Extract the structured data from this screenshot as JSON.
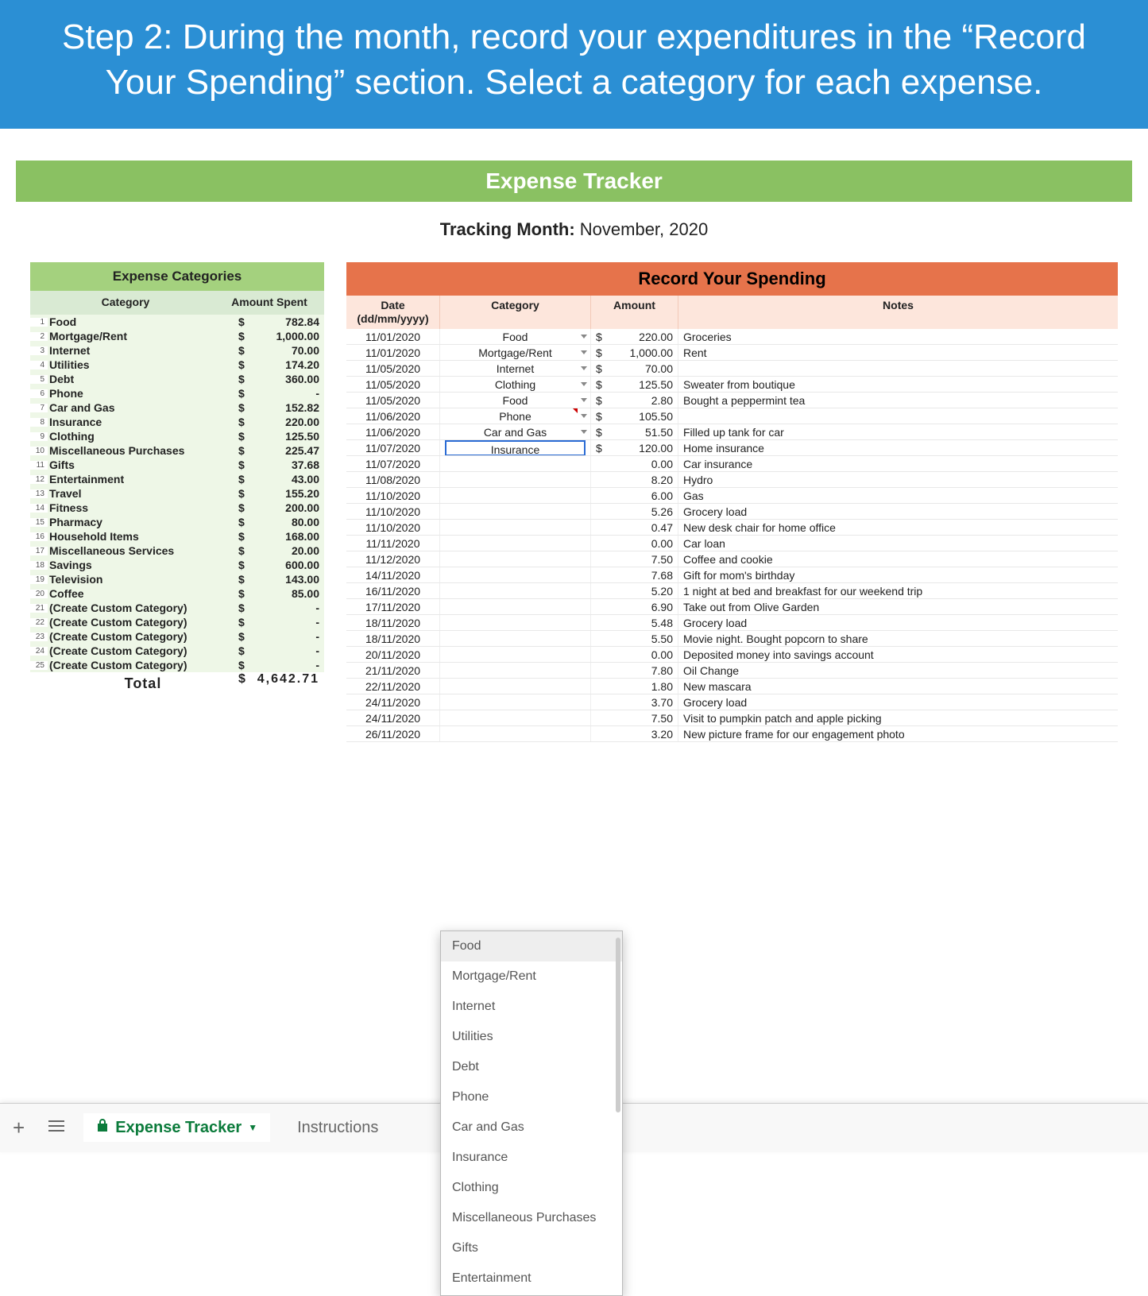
{
  "banner": "Step 2: During the month, record your expenditures in the “Record Your Spending” section. Select a category for each expense.",
  "tracker_title": "Expense Tracker",
  "month_label": "Tracking Month:",
  "month_value": "November, 2020",
  "categories_header": "Expense Categories",
  "categories_col1": "Category",
  "categories_col2": "Amount Spent",
  "total_label": "Total",
  "total_amount": "4,642.71",
  "categories": [
    {
      "n": "1",
      "name": "Food",
      "amt": "782.84"
    },
    {
      "n": "2",
      "name": "Mortgage/Rent",
      "amt": "1,000.00"
    },
    {
      "n": "3",
      "name": "Internet",
      "amt": "70.00"
    },
    {
      "n": "4",
      "name": "Utilities",
      "amt": "174.20"
    },
    {
      "n": "5",
      "name": "Debt",
      "amt": "360.00"
    },
    {
      "n": "6",
      "name": "Phone",
      "amt": "-"
    },
    {
      "n": "7",
      "name": "Car and Gas",
      "amt": "152.82"
    },
    {
      "n": "8",
      "name": "Insurance",
      "amt": "220.00"
    },
    {
      "n": "9",
      "name": "Clothing",
      "amt": "125.50"
    },
    {
      "n": "10",
      "name": "Miscellaneous Purchases",
      "amt": "225.47"
    },
    {
      "n": "11",
      "name": "Gifts",
      "amt": "37.68"
    },
    {
      "n": "12",
      "name": "Entertainment",
      "amt": "43.00"
    },
    {
      "n": "13",
      "name": "Travel",
      "amt": "155.20"
    },
    {
      "n": "14",
      "name": "Fitness",
      "amt": "200.00"
    },
    {
      "n": "15",
      "name": "Pharmacy",
      "amt": "80.00"
    },
    {
      "n": "16",
      "name": "Household Items",
      "amt": "168.00"
    },
    {
      "n": "17",
      "name": "Miscellaneous Services",
      "amt": "20.00"
    },
    {
      "n": "18",
      "name": "Savings",
      "amt": "600.00"
    },
    {
      "n": "19",
      "name": "Television",
      "amt": "143.00"
    },
    {
      "n": "20",
      "name": "Coffee",
      "amt": "85.00"
    },
    {
      "n": "21",
      "name": "(Create Custom Category)",
      "amt": "-"
    },
    {
      "n": "22",
      "name": "(Create Custom Category)",
      "amt": "-"
    },
    {
      "n": "23",
      "name": "(Create Custom Category)",
      "amt": "-"
    },
    {
      "n": "24",
      "name": "(Create Custom Category)",
      "amt": "-"
    },
    {
      "n": "25",
      "name": "(Create Custom Category)",
      "amt": "-"
    }
  ],
  "record_header": "Record Your Spending",
  "record_cols": {
    "date": "Date (dd/mm/yyyy)",
    "cat": "Category",
    "amt": "Amount",
    "note": "Notes"
  },
  "records": [
    {
      "date": "11/01/2020",
      "cat": "Food",
      "dd": true,
      "amt": "220.00",
      "note": "Groceries"
    },
    {
      "date": "11/01/2020",
      "cat": "Mortgage/Rent",
      "dd": true,
      "amt": "1,000.00",
      "note": "Rent"
    },
    {
      "date": "11/05/2020",
      "cat": "Internet",
      "dd": true,
      "amt": "70.00",
      "note": ""
    },
    {
      "date": "11/05/2020",
      "cat": "Clothing",
      "dd": true,
      "amt": "125.50",
      "note": "Sweater from boutique"
    },
    {
      "date": "11/05/2020",
      "cat": "Food",
      "dd": true,
      "amt": "2.80",
      "note": "Bought a peppermint tea"
    },
    {
      "date": "11/06/2020",
      "cat": "Phone",
      "dd": true,
      "red": true,
      "amt": "105.50",
      "note": ""
    },
    {
      "date": "11/06/2020",
      "cat": "Car and Gas",
      "dd": true,
      "amt": "51.50",
      "note": "Filled up tank for car"
    },
    {
      "date": "11/07/2020",
      "cat": "Insurance",
      "active": true,
      "amt": "120.00",
      "note": "Home insurance"
    },
    {
      "date": "11/07/2020",
      "cat": "",
      "amt_tail": "0.00",
      "note": "Car insurance"
    },
    {
      "date": "11/08/2020",
      "cat": "",
      "amt_tail": "8.20",
      "note": "Hydro"
    },
    {
      "date": "11/10/2020",
      "cat": "",
      "amt_tail": "6.00",
      "note": "Gas"
    },
    {
      "date": "11/10/2020",
      "cat": "",
      "amt_tail": "5.26",
      "note": "Grocery load"
    },
    {
      "date": "11/10/2020",
      "cat": "",
      "amt_tail": "0.47",
      "note": "New desk chair for home office"
    },
    {
      "date": "11/11/2020",
      "cat": "",
      "amt_tail": "0.00",
      "note": "Car loan"
    },
    {
      "date": "11/12/2020",
      "cat": "",
      "amt_tail": "7.50",
      "note": "Coffee and cookie"
    },
    {
      "date": "14/11/2020",
      "cat": "",
      "amt_tail": "7.68",
      "note": "Gift for mom's birthday"
    },
    {
      "date": "16/11/2020",
      "cat": "",
      "amt_tail": "5.20",
      "note": "1 night at bed and breakfast for our weekend trip"
    },
    {
      "date": "17/11/2020",
      "cat": "",
      "amt_tail": "6.90",
      "note": "Take out from Olive Garden"
    },
    {
      "date": "18/11/2020",
      "cat": "",
      "amt_tail": "5.48",
      "note": "Grocery load"
    },
    {
      "date": "18/11/2020",
      "cat": "",
      "amt_tail": "5.50",
      "note": "Movie night. Bought popcorn to share"
    },
    {
      "date": "20/11/2020",
      "cat": "",
      "amt_tail": "0.00",
      "note": "Deposited money into savings account"
    },
    {
      "date": "21/11/2020",
      "cat": "",
      "amt_tail": "7.80",
      "note": "Oil Change"
    },
    {
      "date": "22/11/2020",
      "cat": "",
      "amt_tail": "1.80",
      "note": "New mascara"
    },
    {
      "date": "24/11/2020",
      "cat": "",
      "amt_tail": "3.70",
      "note": "Grocery load"
    },
    {
      "date": "24/11/2020",
      "cat": "",
      "amt_tail": "7.50",
      "note": "Visit to pumpkin patch and apple picking"
    },
    {
      "date": "26/11/2020",
      "cat": "",
      "amt_tail": "3.20",
      "note": "New picture frame for our engagement photo"
    }
  ],
  "dropdown_options": [
    "Food",
    "Mortgage/Rent",
    "Internet",
    "Utilities",
    "Debt",
    "Phone",
    "Car and Gas",
    "Insurance",
    "Clothing",
    "Miscellaneous Purchases",
    "Gifts",
    "Entertainment"
  ],
  "tabs": {
    "active": "Expense Tracker",
    "other": "Instructions"
  }
}
